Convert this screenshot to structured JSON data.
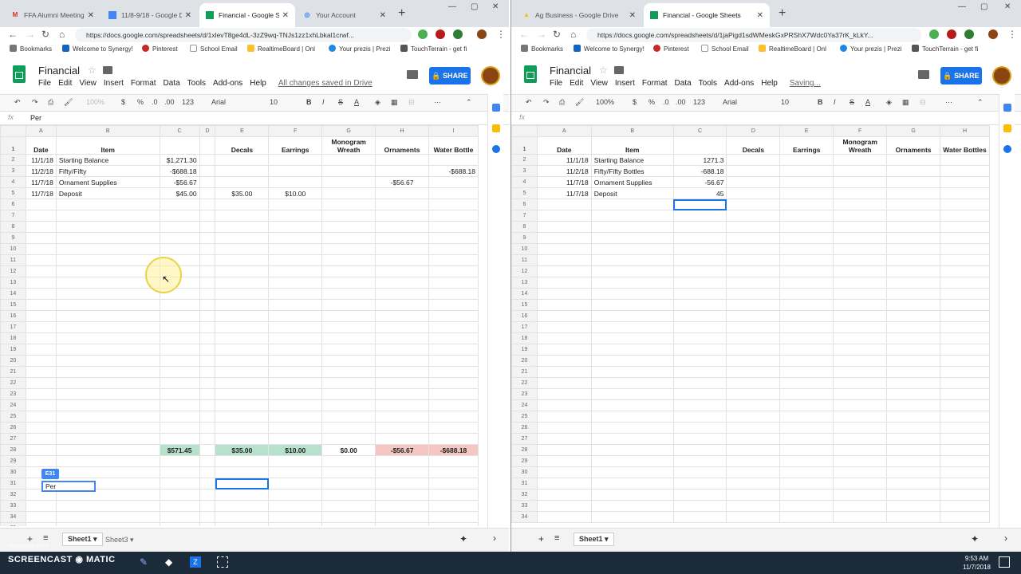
{
  "left": {
    "tabs": [
      {
        "label": "FFA Alumni Meeting"
      },
      {
        "label": "11/8-9/18 - Google D"
      },
      {
        "label": "Financial - Google Sh"
      },
      {
        "label": "Your Account"
      }
    ],
    "url": "https://docs.google.com/spreadsheets/d/1xlevT8ge4dL-3zZ9wq-TNJs1zz1xhLbkal1crwf...",
    "bookmarks": [
      "Bookmarks",
      "Welcome to Synergy!",
      "Pinterest",
      "School Email",
      "RealtimeBoard | Onl",
      "Your prezis | Prezi",
      "TouchTerrain - get fi"
    ],
    "doc_title": "Financial",
    "menu": [
      "File",
      "Edit",
      "View",
      "Insert",
      "Format",
      "Data",
      "Tools",
      "Add-ons",
      "Help"
    ],
    "save_status": "All changes saved in Drive",
    "share": "SHARE",
    "toolbar": {
      "zoom": "100%",
      "currency": "$",
      "percent": "%",
      "dec0": ".0",
      "dec00": ".00",
      "numfmt": "123",
      "font": "Arial",
      "size": "10",
      "bold": "B",
      "italic": "I",
      "strike": "S",
      "color": "A"
    },
    "fx_label": "fx",
    "formula": "Per",
    "cols": [
      "A",
      "B",
      "C",
      "D",
      "E",
      "F",
      "G",
      "H",
      "I"
    ],
    "headers": [
      "Date",
      "Item",
      "",
      "",
      "Decals",
      "Earrings",
      "Monogram Wreath",
      "Ornaments",
      "Water Bottle"
    ],
    "rows": [
      [
        "11/1/18",
        "Starting Balance",
        "$1,271.30",
        "",
        "",
        "",
        "",
        "",
        ""
      ],
      [
        "11/2/18",
        "Fifty/Fifty",
        "-$688.18",
        "",
        "",
        "",
        "",
        "",
        "-$688.18"
      ],
      [
        "11/7/18",
        "Ornament Supplies",
        "-$56.67",
        "",
        "",
        "",
        "",
        "-$56.67",
        ""
      ],
      [
        "11/7/18",
        "Deposit",
        "$45.00",
        "",
        "$35.00",
        "$10.00",
        "",
        "",
        ""
      ]
    ],
    "totals": [
      "",
      "",
      "$571.45",
      "",
      "$35.00",
      "$10.00",
      "$0.00",
      "-$56.67",
      "-$688.18"
    ],
    "cell_ref": "E31",
    "edit_text": "Per",
    "sheets": [
      "Sheet1",
      "Sheet3"
    ]
  },
  "right": {
    "tabs": [
      {
        "label": "Ag Business - Google Drive"
      },
      {
        "label": "Financial - Google Sheets"
      }
    ],
    "url": "https://docs.google.com/spreadsheets/d/1jaPigd1sdWMeskGxPRShX7Wdc0Ya37rK_kLkY...",
    "bookmarks": [
      "Bookmarks",
      "Welcome to Synergy!",
      "Pinterest",
      "School Email",
      "RealtimeBoard | Onl",
      "Your prezis | Prezi",
      "TouchTerrain - get fi"
    ],
    "doc_title": "Financial",
    "menu": [
      "File",
      "Edit",
      "View",
      "Insert",
      "Format",
      "Data",
      "Tools",
      "Add-ons",
      "Help"
    ],
    "save_status": "Saving...",
    "share": "SHARE",
    "toolbar": {
      "zoom": "100%",
      "currency": "$",
      "percent": "%",
      "dec0": ".0",
      "dec00": ".00",
      "numfmt": "123",
      "font": "Arial",
      "size": "10",
      "bold": "B",
      "italic": "I",
      "strike": "S",
      "color": "A"
    },
    "fx_label": "fx",
    "formula": "",
    "cols": [
      "A",
      "B",
      "C",
      "D",
      "E",
      "F",
      "G",
      "H"
    ],
    "headers": [
      "Date",
      "Item",
      "",
      "Decals",
      "Earrings",
      "Monogram Wreath",
      "Ornaments",
      "Water Bottles"
    ],
    "rows": [
      [
        "11/1/18",
        "Starting Balance",
        "1271.3",
        "",
        "",
        "",
        "",
        ""
      ],
      [
        "11/2/18",
        "Fifty/Fifty Bottles",
        "-688.18",
        "",
        "",
        "",
        "",
        ""
      ],
      [
        "11/7/18",
        "Ornament Supplies",
        "-56.67",
        "",
        "",
        "",
        "",
        ""
      ],
      [
        "11/7/18",
        "Deposit",
        "45",
        "",
        "",
        "",
        "",
        ""
      ]
    ],
    "sheets": [
      "Sheet1"
    ]
  },
  "taskbar": {
    "recorder": "RECORDED WITH",
    "brand": "SCREENCAST",
    "brand2": "MATIC",
    "time": "9:53 AM",
    "date": "11/7/2018"
  }
}
